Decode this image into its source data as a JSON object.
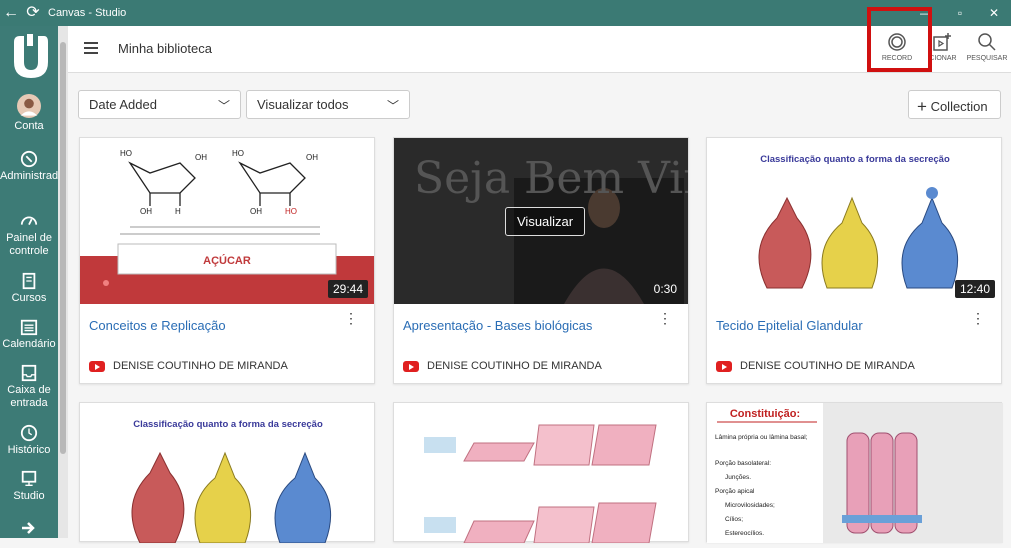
{
  "window": {
    "title": "Canvas - Studio",
    "back_icon": "←",
    "refresh_icon": "⟳"
  },
  "sidebar": {
    "items": [
      {
        "label": "Conta",
        "icon": "avatar"
      },
      {
        "label": "Administrador",
        "icon": "shield-icon"
      },
      {
        "label": "Painel de controle",
        "icon": "dashboard-icon"
      },
      {
        "label": "Cursos",
        "icon": "book-icon"
      },
      {
        "label": "Calendário",
        "icon": "calendar-icon"
      },
      {
        "label": "Caixa de entrada",
        "icon": "inbox-icon"
      },
      {
        "label": "Histórico",
        "icon": "clock-icon"
      },
      {
        "label": "Studio",
        "icon": "studio-icon"
      }
    ]
  },
  "header": {
    "title": "Minha biblioteca"
  },
  "toolbar": {
    "record_label": "RECORD",
    "add_label": "ICIONAR",
    "search_label": "PESQUISAR"
  },
  "filters": {
    "sort_value": "Date Added",
    "view_value": "Visualizar todos",
    "collection_label": "Collection"
  },
  "cards": [
    {
      "title": "Conceitos e Replicação",
      "duration": "29:44",
      "owner": "DENISE COUTINHO DE MIRANDA",
      "thumb_text": "AÇÚCAR"
    },
    {
      "title": "Apresentação - Bases biológicas",
      "duration": "0:30",
      "owner": "DENISE COUTINHO DE MIRANDA",
      "overlay": "Visualizar",
      "thumb_text": "Seja Bem Vindo"
    },
    {
      "title": "Tecido Epitelial Glandular",
      "duration": "12:40",
      "owner": "DENISE COUTINHO DE MIRANDA",
      "thumb_text": "Classificação quanto a forma da secreção"
    },
    {
      "thumb_text": "Classificação quanto a forma da secreção"
    },
    {
      "thumb_text": ""
    },
    {
      "thumb_text": "Constituição:",
      "list": [
        "Lâmina própria ou lâmina basal;",
        "Porção basolateral:",
        "Junções.",
        "Porção apical",
        "Microvilosidades;",
        "Cílios;",
        "Estereocílios."
      ]
    }
  ],
  "colors": {
    "sidebar": "#3d7b76",
    "link": "#2a6db5",
    "highlight": "#d01010"
  }
}
